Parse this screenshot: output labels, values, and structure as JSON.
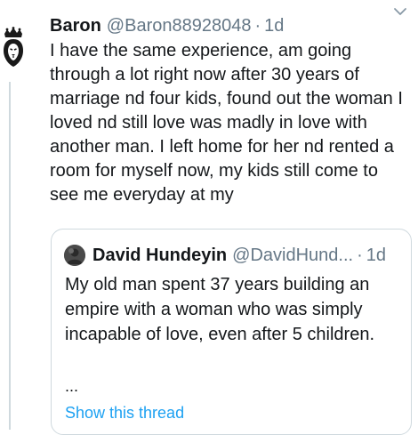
{
  "tweet": {
    "author_name": "Baron",
    "author_handle": "@Baron88928048",
    "separator": "·",
    "time": "1d",
    "avatar_icon": "lion-crown-icon",
    "text": "I have the same experience, am going through a lot right now after 30 years of marriage nd four kids, found out the woman I loved nd still love was madly in love with another man. I left home for her nd rented a room for myself now, my kids still come to see me everyday at my",
    "menu_icon": "chevron-down-icon"
  },
  "quoted_tweet": {
    "author_name": "David Hundeyin",
    "author_handle": "@DavidHund...",
    "separator": "·",
    "time": "1d",
    "text": "My old man spent 37 years building an empire with a woman who was simply incapable of love, even after 5 children.",
    "ellipsis": "...",
    "show_thread_label": "Show this thread"
  },
  "colors": {
    "text": "#14171a",
    "secondary": "#657786",
    "link": "#1da1f2",
    "border": "#cfd9de"
  }
}
